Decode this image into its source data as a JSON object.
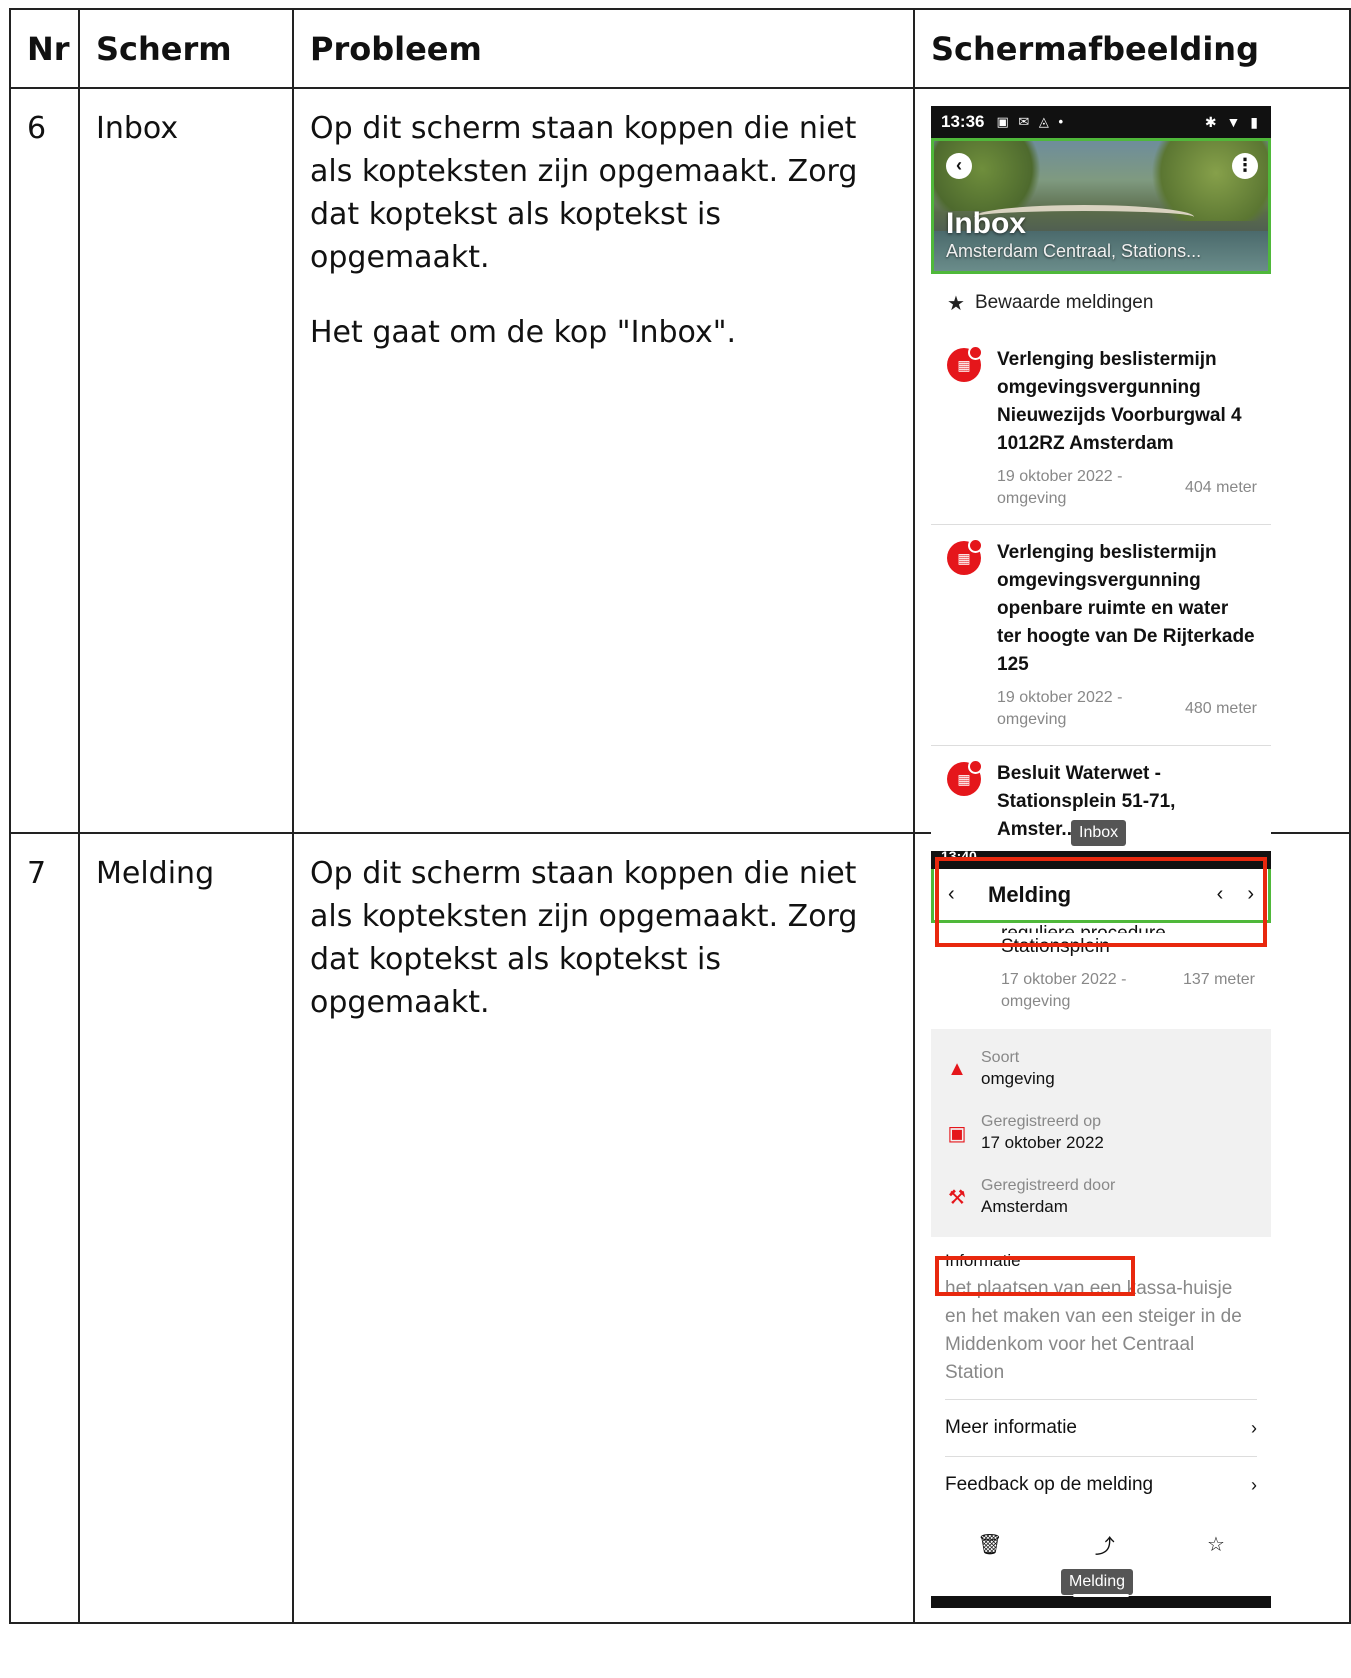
{
  "headers": {
    "nr": "Nr",
    "scherm": "Scherm",
    "probleem": "Probleem",
    "afbeelding": "Schermafbeelding"
  },
  "rows": [
    {
      "nr": "6",
      "scherm": "Inbox",
      "probleem": "Op dit scherm staan koppen die niet als kopteksten zijn opgemaakt. Zorg dat koptekst als koptekst is opgemaakt.",
      "extra": "Het gaat om de kop \"Inbox\"."
    },
    {
      "nr": "7",
      "scherm": "Melding",
      "probleem": "Op dit scherm staan koppen die niet als kopteksten zijn opgemaakt. Zorg dat koptekst als koptekst is opgemaakt."
    }
  ],
  "phone1": {
    "time": "13:36",
    "hero_title": "Inbox",
    "hero_subtitle": "Amsterdam Centraal, Stations...",
    "saved_label": "Bewaarde meldingen",
    "items": [
      {
        "title": "Verlenging beslistermijn omgevingsvergunning Nieuwezijds Voorburgwal 4 1012RZ Amsterdam",
        "date": "19 oktober 2022 - omgeving",
        "distance": "404 meter"
      },
      {
        "title": "Verlenging beslistermijn omgevingsvergunning openbare ruimte en water ter hoogte van De Rijterkade 125",
        "date": "19 oktober 2022 - omgeving",
        "distance": "480 meter"
      },
      {
        "title": "Besluit Waterwet - Stationsplein 51-71, Amster..."
      }
    ],
    "tooltip": "Inbox"
  },
  "phone2": {
    "time": "13:40",
    "title": "Melding",
    "cut_line": "reguliere procedure",
    "subtitle": "Stationsplein",
    "date": "17 oktober 2022 - omgeving",
    "distance": "137 meter",
    "info": [
      {
        "label": "Soort",
        "value": "omgeving",
        "icon": "shapes-icon"
      },
      {
        "label": "Geregistreerd op",
        "value": "17 oktober 2022",
        "icon": "calendar-icon"
      },
      {
        "label": "Geregistreerd door",
        "value": "Amsterdam",
        "icon": "gavel-icon"
      }
    ],
    "section_title": "Informatie",
    "description": "het plaatsen van een kassa-huisje en het maken van een steiger in de Middenkom voor het Centraal Station",
    "links": [
      "Meer informatie",
      "Feedback op de melding"
    ],
    "tooltip": "Melding"
  },
  "colors": {
    "accent_red": "#e5161b",
    "highlight_green": "#4fb83a",
    "annotation_red": "#e8280e"
  }
}
